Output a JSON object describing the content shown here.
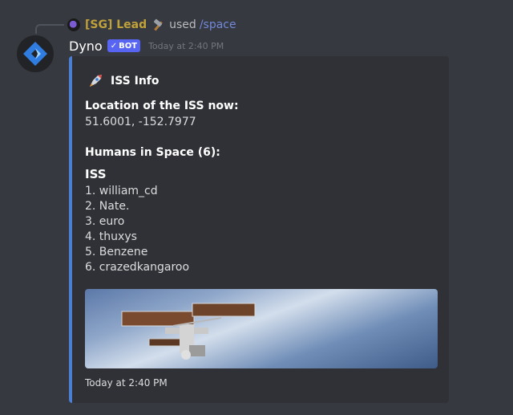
{
  "reply": {
    "name": "[SG] Lead",
    "used": "used",
    "command": "/space"
  },
  "message": {
    "username": "Dyno",
    "badge": "BOT",
    "timestamp": "Today at 2:40 PM"
  },
  "embed": {
    "title": "ISS Info",
    "location_label": "Location of the ISS now:",
    "location_value": "51.6001, -152.7977",
    "humans_label": "Humans in Space (6):",
    "station": "ISS",
    "crew": [
      "1. william_cd",
      "2. Nate.",
      "3. euro",
      "4. thuxys",
      "5. Benzene",
      "6. crazedkangaroo"
    ],
    "footer": "Today at 2:40 PM",
    "accent_color": "#4a7fd4",
    "image_icon": "iss-photo"
  },
  "colors": {
    "background": "#36393f",
    "embed_bg": "#2f3136",
    "reply_name": "#c1a23a",
    "badge": "#5865f2",
    "command": "#7289da"
  }
}
